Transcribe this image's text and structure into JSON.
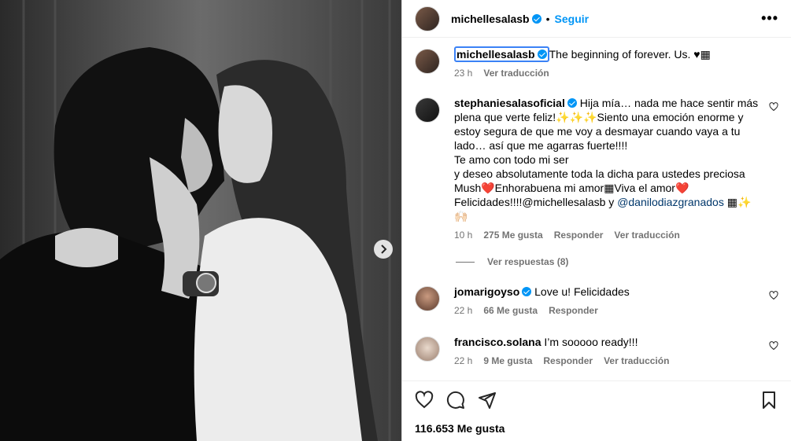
{
  "post": {
    "author": "michellesalasb",
    "follow_label": "Seguir",
    "more_label": "•••",
    "dot": "•",
    "caption": {
      "username": "michellesalasb",
      "text": "The beginning of forever. Us. ♥▦",
      "time": "23 h",
      "translate": "Ver traducción"
    },
    "likes": "116.653 Me gusta"
  },
  "comments": [
    {
      "username": "stephaniesalasoficial",
      "lines": [
        "Hija mía… nada me hace sentir más",
        "plena que verte feliz!✨✨✨Siento una emoción enorme y",
        "estoy segura de que me voy a desmayar cuando vaya a tu",
        "lado… así que me agarras fuerte!!!!",
        "Te amo con todo mi ser",
        "y deseo absolutamente toda la dicha para ustedes preciosa",
        "Mush❤️Enhorabuena mi amor▦Viva el amor❤️",
        "Felicidades!!!!@michellesalasb y "
      ],
      "mention_link": "@danilodiazgranados",
      "tail": " ▦✨",
      "last_line": "🙌🏻",
      "time": "10 h",
      "likes": "275 Me gusta",
      "reply": "Responder",
      "translate": "Ver traducción"
    },
    {
      "username": "jomarigoyso",
      "text": "Love u! Felicidades",
      "time": "22 h",
      "likes": "66 Me gusta",
      "reply": "Responder"
    },
    {
      "username": "francisco.solana",
      "text": "I’m sooooo ready!!!",
      "time": "22 h",
      "likes": "9 Me gusta",
      "reply": "Responder",
      "translate": "Ver traducción"
    }
  ],
  "view_replies": "Ver respuestas (8)",
  "icons": {
    "like": "heart-icon",
    "comment": "comment-icon",
    "share": "send-icon",
    "save": "bookmark-icon",
    "next": "chevron-right-icon"
  },
  "colors": {
    "accent": "#0095f6",
    "muted": "#737373",
    "link": "#00376b"
  }
}
